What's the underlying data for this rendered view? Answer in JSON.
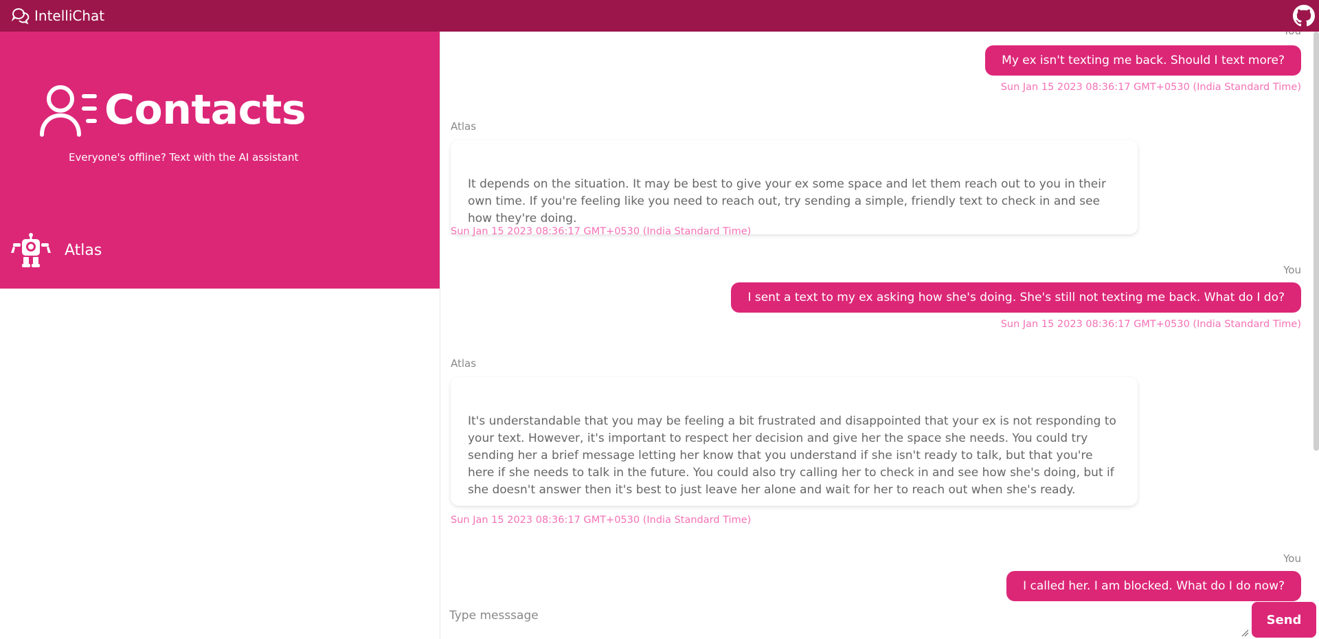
{
  "app": {
    "name": "IntelliChat"
  },
  "sidebar": {
    "title": "Contacts",
    "subtitle": "Everyone's offline? Text with the AI assistant",
    "contacts": [
      {
        "name": "Atlas",
        "icon": "robot-icon"
      }
    ]
  },
  "chat": {
    "top_partial_sender": "You",
    "messages": [
      {
        "sender": "You",
        "text": "My ex isn't texting me back. Should I text more?",
        "timestamp": "Sun Jan 15 2023 08:36:17 GMT+0530 (India Standard Time)"
      },
      {
        "sender": "Atlas",
        "text": "It depends on the situation. It may be best to give your ex some space and let them reach out to you in their own time. If you're feeling like you need to reach out, try sending a simple, friendly text to check in and see how they're doing.",
        "timestamp": "Sun Jan 15 2023 08:36:17 GMT+0530 (India Standard Time)"
      },
      {
        "sender": "You",
        "text": "I sent a text to my ex asking how she's doing. She's still not texting me back. What do I do?",
        "timestamp": "Sun Jan 15 2023 08:36:17 GMT+0530 (India Standard Time)"
      },
      {
        "sender": "Atlas",
        "text": "It's understandable that you may be feeling a bit frustrated and disappointed that your ex is not responding to your text. However, it's important to respect her decision and give her the space she needs. You could try sending her a brief message letting her know that you understand if she isn't ready to talk, but that you're here if she needs to talk in the future. You could also try calling her to check in and see how she's doing, but if she doesn't answer then it's best to just leave her alone and wait for her to reach out when she's ready.",
        "timestamp": "Sun Jan 15 2023 08:36:17 GMT+0530 (India Standard Time)"
      },
      {
        "sender": "You",
        "text": "I called her. I am blocked. What do I do now?"
      }
    ]
  },
  "composer": {
    "placeholder": "Type messsage",
    "value": "",
    "send_label": "Send"
  },
  "colors": {
    "navbar": "#9c164b",
    "accent": "#dc2777",
    "timestamp": "#f472b6"
  }
}
